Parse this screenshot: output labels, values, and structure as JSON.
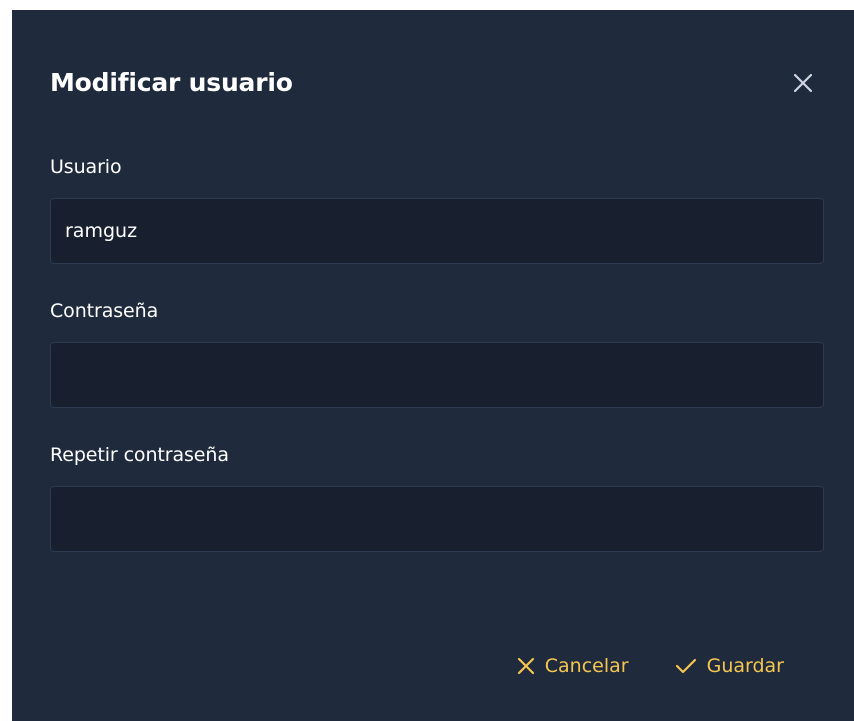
{
  "dialog": {
    "title": "Modificar usuario",
    "close_icon": "close-icon"
  },
  "fields": {
    "usuario": {
      "label": "Usuario",
      "value": "ramguz",
      "placeholder": ""
    },
    "contrasena": {
      "label": "Contraseña",
      "value": "",
      "placeholder": ""
    },
    "repetir": {
      "label": "Repetir contraseña",
      "value": "",
      "placeholder": ""
    }
  },
  "footer": {
    "cancel_label": "Cancelar",
    "cancel_icon": "close-icon",
    "save_label": "Guardar",
    "save_icon": "check-icon"
  },
  "colors": {
    "dialog_bg": "#1f2a3c",
    "input_bg": "#182030",
    "input_border": "#2d3a4f",
    "accent": "#f5c64f",
    "text": "#ffffff"
  }
}
